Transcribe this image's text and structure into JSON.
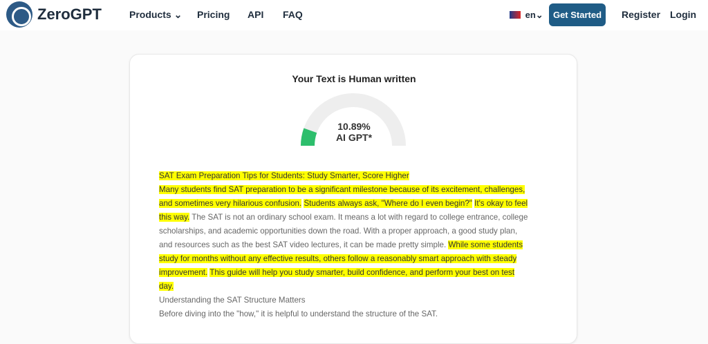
{
  "header": {
    "brand": "ZeroGPT",
    "nav": {
      "products": "Products ⌄",
      "pricing": "Pricing",
      "api": "API",
      "faq": "FAQ"
    },
    "language": "en⌄",
    "cta": "Get Started",
    "register": "Register",
    "login": "Login"
  },
  "result": {
    "title": "Your Text is Human written",
    "percentage": "10.89%",
    "label": "AI GPT*",
    "score_value": 10.89,
    "colors": {
      "gauge_track": "#eeeeee",
      "gauge_fill": "#2dbe6c",
      "highlight": "#ffff00"
    }
  },
  "text": {
    "title": "SAT Exam Preparation Tips for Students: Study Smarter, Score Higher",
    "p1a": "Many students find SAT preparation to be a significant milestone because of its excitement, challenges,",
    "p1b": "and sometimes very hilarious confusion.",
    "p1c": "Students always ask, \"Where do I even begin?\"",
    "p1d": "It's okay to feel",
    "p1e": "this way.",
    "p1f": "The SAT is not an ordinary school exam. It means a lot with regard to college entrance, college",
    "p1g": "scholarships, and academic opportunities down the road. With a proper approach, a good study plan,",
    "p1h": "and resources such as the best SAT video lectures, it can be made pretty simple.",
    "p1i": "While some students",
    "p1j": "study for months without any effective results, others follow a reasonably smart approach with steady",
    "p1k": "improvement.",
    "p1l": "This guide will help you study smarter, build confidence, and perform your best on test",
    "p1m": "day.",
    "subheading": "Understanding the SAT Structure Matters",
    "p2": "Before diving into the \"how,\" it is helpful to understand the structure of the SAT."
  }
}
